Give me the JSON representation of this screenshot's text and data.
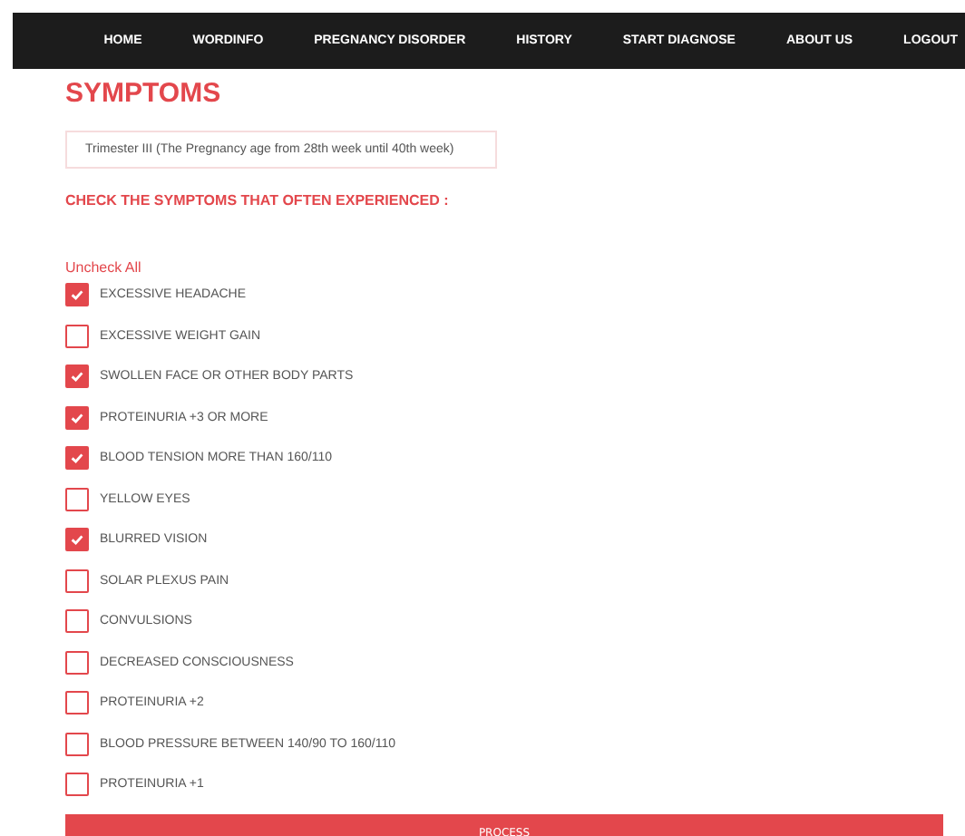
{
  "nav": [
    "HOME",
    "WORDINFO",
    "PREGNANCY DISORDER",
    "HISTORY",
    "START DIAGNOSE",
    "ABOUT US",
    "LOGOUT"
  ],
  "title": "SYMPTOMS",
  "trimester": {
    "value": "Trimester III (The Pregnancy age from 28th week until 40th week)"
  },
  "heading": "CHECK THE SYMPTOMS THAT OFTEN EXPERIENCED :",
  "uncheck_all": "Uncheck All",
  "symptoms": [
    {
      "label": "EXCESSIVE HEADACHE",
      "checked": true
    },
    {
      "label": "EXCESSIVE WEIGHT GAIN",
      "checked": false
    },
    {
      "label": "SWOLLEN FACE OR OTHER BODY PARTS",
      "checked": true
    },
    {
      "label": "PROTEINURIA +3 OR MORE",
      "checked": true
    },
    {
      "label": "BLOOD TENSION MORE THAN 160/110",
      "checked": true
    },
    {
      "label": "YELLOW EYES",
      "checked": false
    },
    {
      "label": "BLURRED VISION",
      "checked": true
    },
    {
      "label": "SOLAR PLEXUS PAIN",
      "checked": false
    },
    {
      "label": "CONVULSIONS",
      "checked": false
    },
    {
      "label": "DECREASED CONSCIOUSNESS",
      "checked": false
    },
    {
      "label": "PROTEINURIA +2",
      "checked": false
    },
    {
      "label": "BLOOD PRESSURE BETWEEN 140/90 TO 160/110",
      "checked": false
    },
    {
      "label": "PROTEINURIA +1",
      "checked": false
    }
  ],
  "process_button": "PROCESS"
}
